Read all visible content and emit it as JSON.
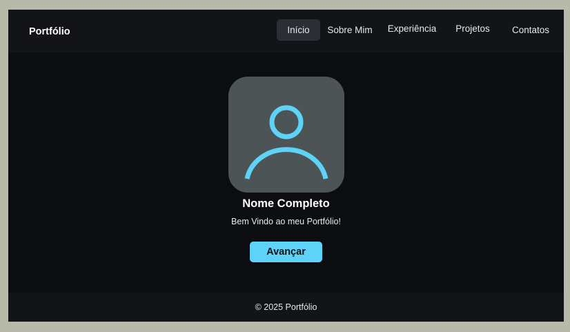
{
  "header": {
    "brand": "Portfólio",
    "nav": [
      {
        "label": "Início",
        "active": true
      },
      {
        "label": "Sobre Mim",
        "active": false
      },
      {
        "label": "Experiência",
        "active": false
      },
      {
        "label": "Projetos",
        "active": false
      },
      {
        "label": "Contatos",
        "active": false
      }
    ]
  },
  "hero": {
    "avatar_icon": "user-icon",
    "name": "Nome Completo",
    "tagline": "Bem Vindo ao meu Portfólio!",
    "cta_label": "Avançar"
  },
  "footer": {
    "text": "© 2025 Portfólio"
  },
  "colors": {
    "accent": "#5ed3f7",
    "background": "#0b0d10",
    "header_bg": "#121418",
    "avatar_bg": "#4c5456",
    "active_nav_bg": "#2b2f35",
    "page_border": "#b9b9a9"
  }
}
